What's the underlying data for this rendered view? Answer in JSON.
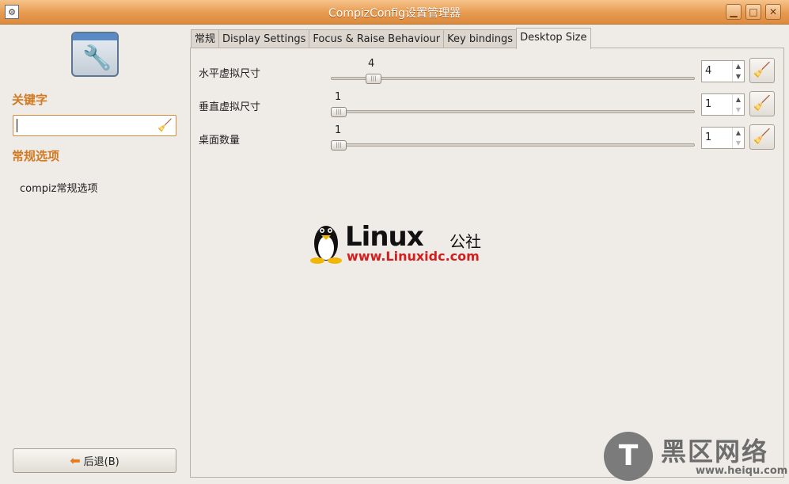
{
  "window": {
    "title": "CompizConfig设置管理器"
  },
  "sidebar": {
    "keyword_heading": "关键字",
    "search_value": "",
    "category_heading": "常规选项",
    "category_item": "compiz常规选项",
    "back_button_label": "后退(B)"
  },
  "tabs": [
    {
      "label": "常规",
      "active": false
    },
    {
      "label": "Display Settings",
      "active": false
    },
    {
      "label": "Focus & Raise Behaviour",
      "active": false
    },
    {
      "label": "Key bindings",
      "active": false
    },
    {
      "label": "Desktop Size",
      "active": true
    }
  ],
  "settings": [
    {
      "label": "水平虚拟尺寸",
      "value": "4",
      "slider_fraction": 0.1,
      "spin_value": "4",
      "spin_down_enabled": true
    },
    {
      "label": "垂直虚拟尺寸",
      "value": "1",
      "slider_fraction": 0.0,
      "spin_value": "1",
      "spin_down_enabled": false
    },
    {
      "label": "桌面数量",
      "value": "1",
      "slider_fraction": 0.0,
      "spin_value": "1",
      "spin_down_enabled": false
    }
  ],
  "watermarks": {
    "linux_word": "Linux",
    "linux_cn": "公社",
    "linux_url": "www.Linuxidc.com",
    "heiqu_cn": "黑区网络",
    "heiqu_url": "www.heiqu.com"
  },
  "colors": {
    "titlebar": "#e69a4f",
    "accent_heading": "#d07a22",
    "watermark_red": "#d41e1e"
  }
}
